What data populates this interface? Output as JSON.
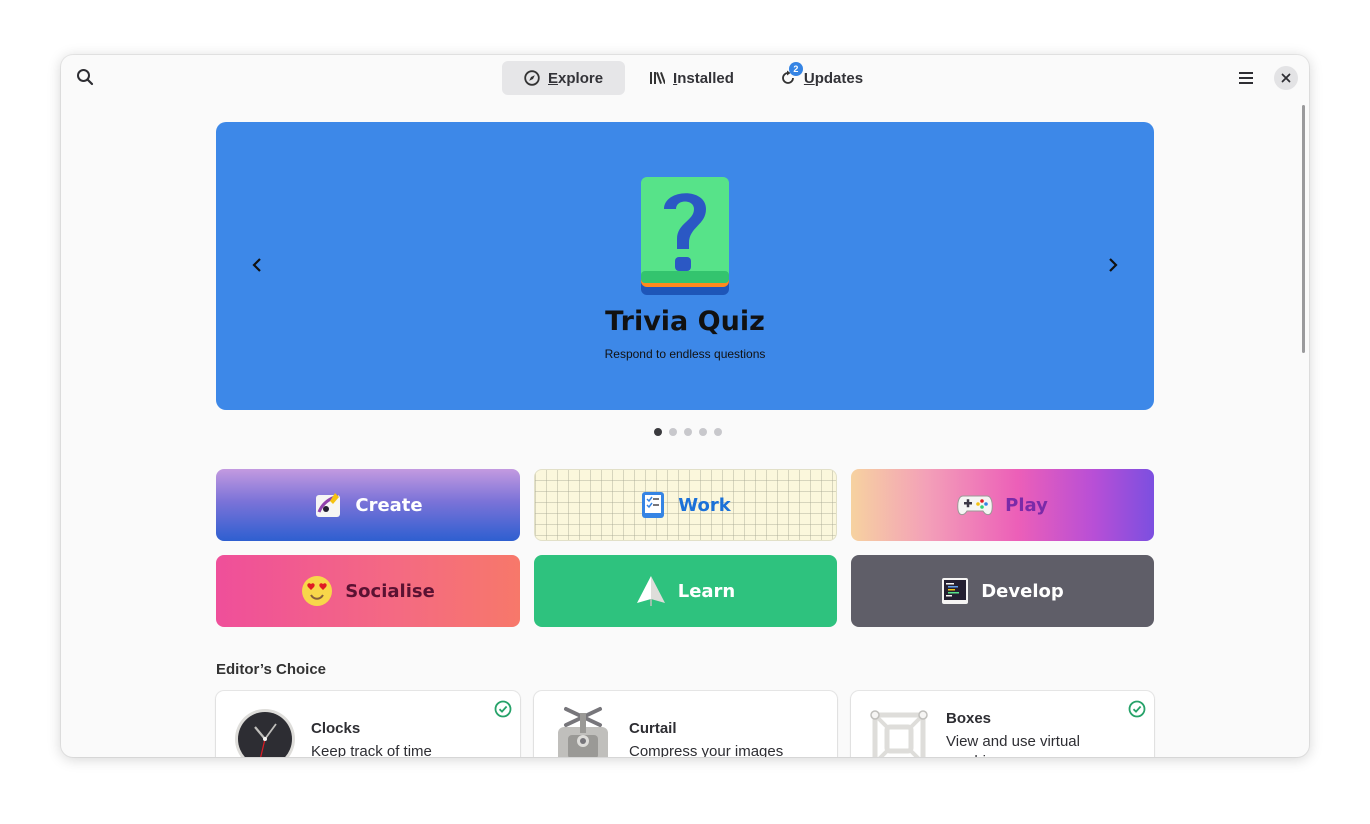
{
  "header": {
    "tabs": [
      {
        "label_mnemonic": "E",
        "label_rest": "xplore",
        "icon": "compass-icon",
        "active": true
      },
      {
        "label_mnemonic": "I",
        "label_rest": "nstalled",
        "icon": "library-icon",
        "active": false
      },
      {
        "label_mnemonic": "U",
        "label_rest": "pdates",
        "icon": "refresh-icon",
        "active": false,
        "badge": "2"
      }
    ],
    "search_icon": "search-icon",
    "menu_icon": "hamburger-menu-icon",
    "close_icon": "close-icon"
  },
  "carousel": {
    "title": "Trivia Quiz",
    "subtitle": "Respond to endless questions",
    "background": "#3d88e8",
    "slide_count": 5,
    "active_slide": 1
  },
  "categories": [
    {
      "label": "Create",
      "icon": "create-icon"
    },
    {
      "label": "Work",
      "icon": "checklist-icon"
    },
    {
      "label": "Play",
      "icon": "gamepad-icon"
    },
    {
      "label": "Socialise",
      "icon": "heart-eyes-emoji-icon"
    },
    {
      "label": "Learn",
      "icon": "paper-plane-icon"
    },
    {
      "label": "Develop",
      "icon": "terminal-icon"
    }
  ],
  "editors_choice": {
    "title": "Editor’s Choice",
    "apps": [
      {
        "name": "Clocks",
        "description": "Keep track of time",
        "installed": true,
        "icon": "clock-icon"
      },
      {
        "name": "Curtail",
        "description": "Compress your images",
        "installed": false,
        "icon": "vise-icon"
      },
      {
        "name": "Boxes",
        "description": "View and use virtual machines",
        "installed": true,
        "icon": "boxes-icon"
      }
    ]
  },
  "colors": {
    "accent": "#3584e4",
    "success": "#26a269"
  }
}
